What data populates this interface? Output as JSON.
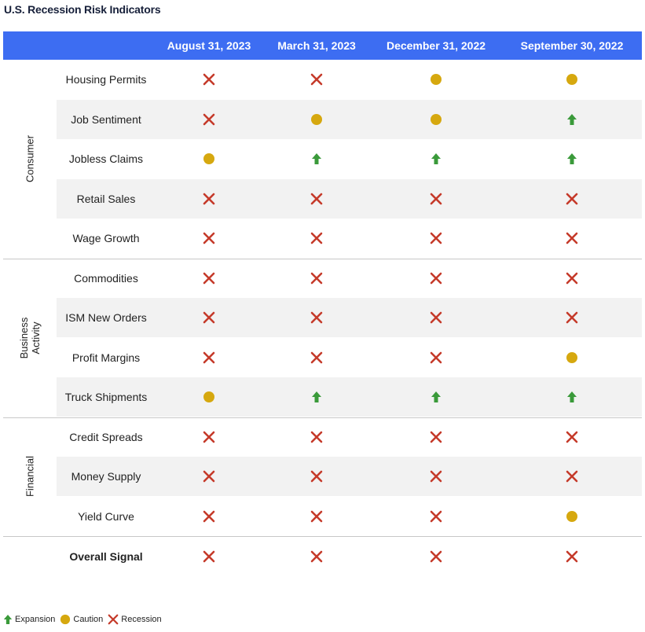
{
  "title": "U.S. Recession Risk Indicators",
  "columns": [
    "August 31, 2023",
    "March 31, 2023",
    "December 31, 2022",
    "September 30, 2022"
  ],
  "colors": {
    "header_bg": "#3d6df2",
    "expansion": "#3a9a3a",
    "caution": "#d6a80f",
    "recession": "#c53a2a"
  },
  "icons": {
    "expansion": "up-arrow-icon",
    "caution": "circle-icon",
    "recession": "x-mark-icon"
  },
  "groups": [
    {
      "name": "Consumer",
      "rows": [
        {
          "label": "Housing Permits",
          "signals": [
            "recession",
            "recession",
            "caution",
            "caution"
          ]
        },
        {
          "label": "Job Sentiment",
          "signals": [
            "recession",
            "caution",
            "caution",
            "expansion"
          ]
        },
        {
          "label": "Jobless Claims",
          "signals": [
            "caution",
            "expansion",
            "expansion",
            "expansion"
          ]
        },
        {
          "label": "Retail Sales",
          "signals": [
            "recession",
            "recession",
            "recession",
            "recession"
          ]
        },
        {
          "label": "Wage Growth",
          "signals": [
            "recession",
            "recession",
            "recession",
            "recession"
          ]
        }
      ]
    },
    {
      "name": "Business Activity",
      "rows": [
        {
          "label": "Commodities",
          "signals": [
            "recession",
            "recession",
            "recession",
            "recession"
          ]
        },
        {
          "label": "ISM New Orders",
          "signals": [
            "recession",
            "recession",
            "recession",
            "recession"
          ]
        },
        {
          "label": "Profit Margins",
          "signals": [
            "recession",
            "recession",
            "recession",
            "caution"
          ]
        },
        {
          "label": "Truck Shipments",
          "signals": [
            "caution",
            "expansion",
            "expansion",
            "expansion"
          ]
        }
      ]
    },
    {
      "name": "Financial",
      "rows": [
        {
          "label": "Credit Spreads",
          "signals": [
            "recession",
            "recession",
            "recession",
            "recession"
          ]
        },
        {
          "label": "Money Supply",
          "signals": [
            "recession",
            "recession",
            "recession",
            "recession"
          ]
        },
        {
          "label": "Yield Curve",
          "signals": [
            "recession",
            "recession",
            "recession",
            "caution"
          ]
        }
      ]
    }
  ],
  "overall": {
    "label": "Overall Signal",
    "signals": [
      "recession",
      "recession",
      "recession",
      "recession"
    ]
  },
  "legend": [
    {
      "key": "expansion",
      "label": "Expansion"
    },
    {
      "key": "caution",
      "label": "Caution"
    },
    {
      "key": "recession",
      "label": "Recession"
    }
  ],
  "chart_data": {
    "type": "table",
    "title": "U.S. Recession Risk Indicators",
    "columns": [
      "August 31, 2023",
      "March 31, 2023",
      "December 31, 2022",
      "September 30, 2022"
    ],
    "categories": [
      "Consumer",
      "Business Activity",
      "Financial"
    ],
    "values": {
      "Housing Permits": [
        "Recession",
        "Recession",
        "Caution",
        "Caution"
      ],
      "Job Sentiment": [
        "Recession",
        "Caution",
        "Caution",
        "Expansion"
      ],
      "Jobless Claims": [
        "Caution",
        "Expansion",
        "Expansion",
        "Expansion"
      ],
      "Retail Sales": [
        "Recession",
        "Recession",
        "Recession",
        "Recession"
      ],
      "Wage Growth": [
        "Recession",
        "Recession",
        "Recession",
        "Recession"
      ],
      "Commodities": [
        "Recession",
        "Recession",
        "Recession",
        "Recession"
      ],
      "ISM New Orders": [
        "Recession",
        "Recession",
        "Recession",
        "Recession"
      ],
      "Profit Margins": [
        "Recession",
        "Recession",
        "Recession",
        "Caution"
      ],
      "Truck Shipments": [
        "Caution",
        "Expansion",
        "Expansion",
        "Expansion"
      ],
      "Credit Spreads": [
        "Recession",
        "Recession",
        "Recession",
        "Recession"
      ],
      "Money Supply": [
        "Recession",
        "Recession",
        "Recession",
        "Recession"
      ],
      "Yield Curve": [
        "Recession",
        "Recession",
        "Recession",
        "Caution"
      ],
      "Overall Signal": [
        "Recession",
        "Recession",
        "Recession",
        "Recession"
      ]
    },
    "legend": [
      "Expansion",
      "Caution",
      "Recession"
    ]
  }
}
